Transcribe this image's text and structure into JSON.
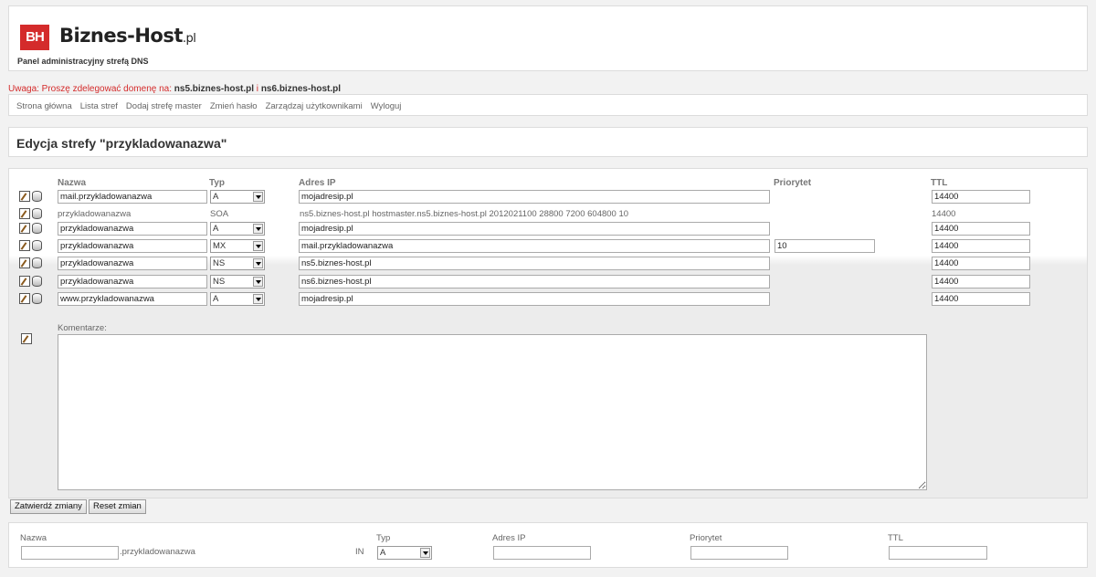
{
  "header": {
    "logo_mark": "BH",
    "brand": "Biznes-Host",
    "brand_tld": ".pl",
    "subtitle": "Panel administracyjny strefą DNS"
  },
  "warning": {
    "prefix": "Uwaga: Proszę zdelegować domenę na:",
    "ns1": "ns5.biznes-host.pl",
    "sep": "i",
    "ns2": "ns6.biznes-host.pl"
  },
  "nav": [
    "Strona główna",
    "Lista stref",
    "Dodaj strefę master",
    "Zmień hasło",
    "Zarządzaj użytkownikami",
    "Wyloguj"
  ],
  "page_title": "Edycja strefy \"przykladowanazwa\"",
  "columns": {
    "name": "Nazwa",
    "type": "Typ",
    "ip": "Adres IP",
    "priority": "Priorytet",
    "ttl": "TTL"
  },
  "records": [
    {
      "name": "mail.przykladowanazwa",
      "type": "A",
      "ip": "mojadresip.pl",
      "priority": "",
      "ttl": "14400",
      "editable": true
    },
    {
      "name": "przykladowanazwa",
      "type": "SOA",
      "ip": "ns5.biznes-host.pl hostmaster.ns5.biznes-host.pl 2012021100 28800 7200 604800 10",
      "priority": "",
      "ttl": "14400",
      "editable": false
    },
    {
      "name": "przykladowanazwa",
      "type": "A",
      "ip": "mojadresip.pl",
      "priority": "",
      "ttl": "14400",
      "editable": true
    },
    {
      "name": "przykladowanazwa",
      "type": "MX",
      "ip": "mail.przykladowanazwa",
      "priority": "10",
      "ttl": "14400",
      "editable": true
    },
    {
      "name": "przykladowanazwa",
      "type": "NS",
      "ip": "ns5.biznes-host.pl",
      "priority": "",
      "ttl": "14400",
      "editable": true
    },
    {
      "name": "przykladowanazwa",
      "type": "NS",
      "ip": "ns6.biznes-host.pl",
      "priority": "",
      "ttl": "14400",
      "editable": true
    },
    {
      "name": "www.przykladowanazwa",
      "type": "A",
      "ip": "mojadresip.pl",
      "priority": "",
      "ttl": "14400",
      "editable": true
    }
  ],
  "comment_label": "Komentarze:",
  "comment_value": "",
  "buttons": {
    "submit": "Zatwierdź zmiany",
    "reset": "Reset zmian"
  },
  "add_form": {
    "name_label": "Nazwa",
    "name_value": "",
    "suffix": ".przykladowanazwa",
    "class": "IN",
    "type_label": "Typ",
    "type_value": "A",
    "ip_label": "Adres IP",
    "ip_value": "",
    "priority_label": "Priorytet",
    "priority_value": "",
    "ttl_label": "TTL",
    "ttl_value": ""
  },
  "colors": {
    "brand_red": "#d42b2b",
    "warning_red": "#d42b2b"
  }
}
